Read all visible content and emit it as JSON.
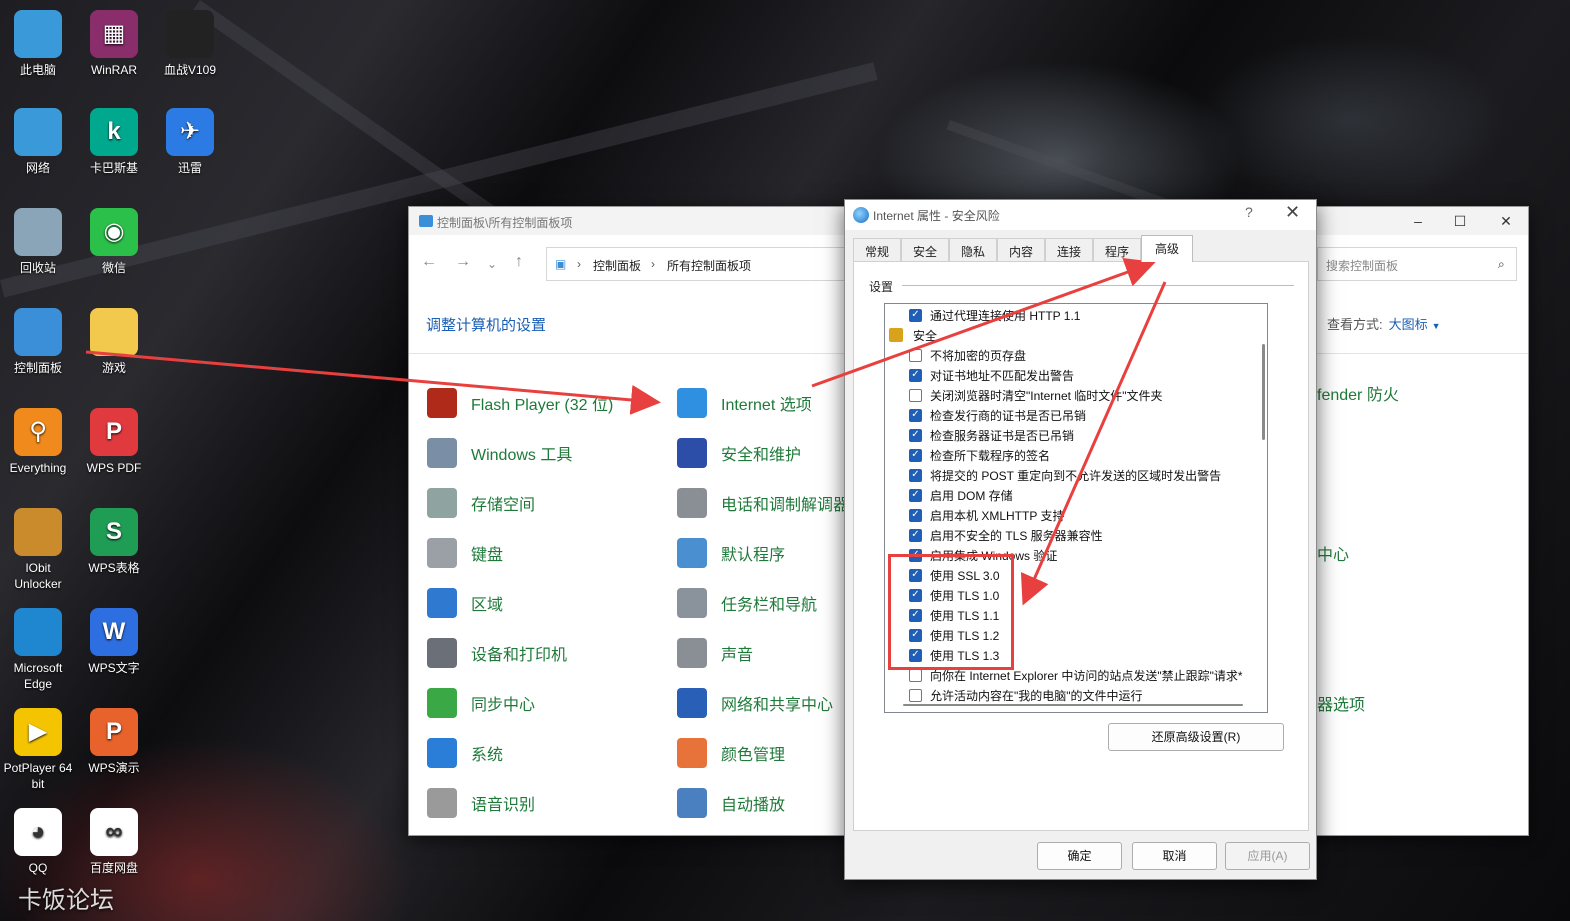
{
  "desktop": {
    "icons": [
      {
        "label": "此电脑",
        "color": "#3a9ad9"
      },
      {
        "label": "WinRAR",
        "color": "#8a2d6b"
      },
      {
        "label": "血战V109",
        "color": "#222222"
      },
      {
        "label": "网络",
        "color": "#3a9ad9"
      },
      {
        "label": "卡巴斯基",
        "color": "#00a88e"
      },
      {
        "label": "迅雷",
        "color": "#2c7be5"
      },
      {
        "label": "回收站",
        "color": "#8aa4b8"
      },
      {
        "label": "微信",
        "color": "#2bc04a"
      },
      {
        "label": "控制面板",
        "color": "#3b8fd8"
      },
      {
        "label": "游戏",
        "color": "#f2c94c"
      },
      {
        "label": "Everything",
        "color": "#f08a1c"
      },
      {
        "label": "WPS PDF",
        "color": "#e0393e"
      },
      {
        "label": "IObit Unlocker",
        "color": "#c98b2b"
      },
      {
        "label": "WPS表格",
        "color": "#1f9d55"
      },
      {
        "label": "Microsoft Edge",
        "color": "#1f86d0"
      },
      {
        "label": "WPS文字",
        "color": "#2d6fe0"
      },
      {
        "label": "PotPlayer 64 bit",
        "color": "#f5c400"
      },
      {
        "label": "WPS演示",
        "color": "#e8622b"
      },
      {
        "label": "QQ",
        "color": "#ffffff"
      },
      {
        "label": "百度网盘",
        "color": "#ffffff"
      }
    ],
    "icon_glyphs": {
      "wps_pdf": "P",
      "wps_sheet": "S",
      "wps_word": "W",
      "wps_ppt": "P",
      "kaspersky": "k",
      "potplayer": "Player"
    },
    "watermark": "卡饭论坛"
  },
  "control_panel": {
    "title": "控制面板\\所有控制面板项",
    "breadcrumb": [
      "控制面板",
      "所有控制面板项"
    ],
    "search_placeholder": "搜索控制面板",
    "heading": "调整计算机的设置",
    "view_by_label": "查看方式:",
    "view_by_value": "大图标",
    "items_col1": [
      "Flash Player (32 位)",
      "Windows 工具",
      "存储空间",
      "键盘",
      "区域",
      "设备和打印机",
      "同步中心",
      "系统",
      "语音识别"
    ],
    "items_col2": [
      "Internet 选项",
      "安全和维护",
      "电话和调制解调器",
      "默认程序",
      "任务栏和导航",
      "声音",
      "网络和共享中心",
      "颜色管理",
      "自动播放"
    ],
    "items_col3_partial": [
      "fender 防火",
      "中心",
      "器选项"
    ]
  },
  "dialog": {
    "title": "Internet 属性 - 安全风险",
    "help": "?",
    "tabs": [
      "常规",
      "安全",
      "隐私",
      "内容",
      "连接",
      "程序",
      "高级"
    ],
    "active_tab": "高级",
    "settings_label": "设置",
    "rows": [
      {
        "type": "check",
        "checked": true,
        "label": "通过代理连接使用 HTTP 1.1"
      },
      {
        "type": "group",
        "label": "安全"
      },
      {
        "type": "check",
        "checked": false,
        "label": "不将加密的页存盘"
      },
      {
        "type": "check",
        "checked": true,
        "label": "对证书地址不匹配发出警告"
      },
      {
        "type": "check",
        "checked": false,
        "label": "关闭浏览器时清空\"Internet 临时文件\"文件夹"
      },
      {
        "type": "check",
        "checked": true,
        "label": "检查发行商的证书是否已吊销"
      },
      {
        "type": "check",
        "checked": true,
        "label": "检查服务器证书是否已吊销"
      },
      {
        "type": "check",
        "checked": true,
        "label": "检查所下载程序的签名"
      },
      {
        "type": "check",
        "checked": true,
        "label": "将提交的 POST 重定向到不允许发送的区域时发出警告"
      },
      {
        "type": "check",
        "checked": true,
        "label": "启用 DOM 存储"
      },
      {
        "type": "check",
        "checked": true,
        "label": "启用本机 XMLHTTP 支持"
      },
      {
        "type": "check",
        "checked": true,
        "label": "启用不安全的 TLS 服务器兼容性"
      },
      {
        "type": "check",
        "checked": true,
        "label": "启用集成 Windows 验证"
      },
      {
        "type": "check",
        "checked": true,
        "label": "使用 SSL 3.0"
      },
      {
        "type": "check",
        "checked": true,
        "label": "使用 TLS 1.0"
      },
      {
        "type": "check",
        "checked": true,
        "label": "使用 TLS 1.1"
      },
      {
        "type": "check",
        "checked": true,
        "label": "使用 TLS 1.2"
      },
      {
        "type": "check",
        "checked": true,
        "label": "使用 TLS 1.3"
      },
      {
        "type": "check",
        "checked": false,
        "label": "向你在 Internet Explorer 中访问的站点发送\"禁止跟踪\"请求*"
      },
      {
        "type": "check",
        "checked": false,
        "label": "允许活动内容在\"我的电脑\"的文件中运行"
      }
    ],
    "restore_button": "还原高级设置(R)",
    "ok_button": "确定",
    "cancel_button": "取消",
    "apply_button": "应用(A)"
  },
  "colors": {
    "accent": "#1f5fb8",
    "link_green": "#1f7a3a",
    "annotation_red": "#e8403e"
  }
}
